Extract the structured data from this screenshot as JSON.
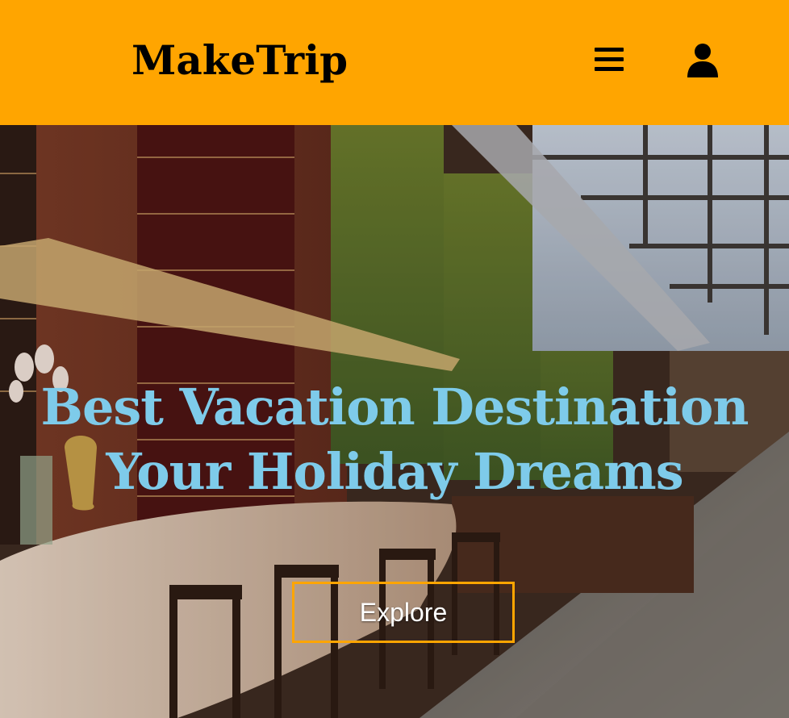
{
  "header": {
    "logo": "MakeTrip",
    "menu_icon": "hamburger-menu-icon",
    "user_icon": "user-icon",
    "background": "#ffa500"
  },
  "hero": {
    "headline_line1": "Best Vacation Destination",
    "headline_line2": "Your Holiday Dreams",
    "headline_color": "#7ecbea",
    "explore_label": "Explore",
    "button_border": "#ffa500"
  }
}
